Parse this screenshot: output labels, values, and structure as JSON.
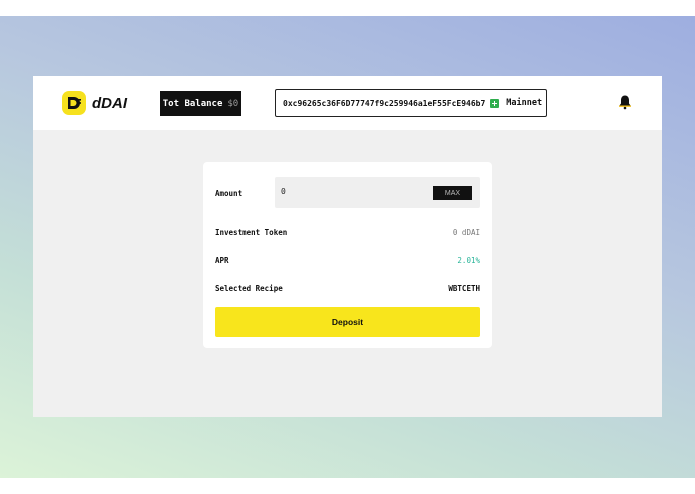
{
  "app": {
    "name": "dDAI"
  },
  "header": {
    "balance_label": "Tot Balance",
    "balance_value": "$0",
    "wallet_address": "0xc96265c36F6D77747f9c259946a1eF55FcE946b7",
    "network": "Mainnet",
    "network_color": "#2fae4e"
  },
  "form": {
    "amount_label": "Amount",
    "amount_value": "0",
    "max_label": "MAX",
    "investment_token_label": "Investment Token",
    "investment_token_value": "0 dDAI",
    "apr_label": "APR",
    "apr_value": "2.01%",
    "recipe_label": "Selected Recipe",
    "recipe_value": "WBTCETH",
    "deposit_label": "Deposit"
  },
  "colors": {
    "accent": "#f8e51c",
    "apr": "#2bb59a",
    "dark": "#111111"
  }
}
